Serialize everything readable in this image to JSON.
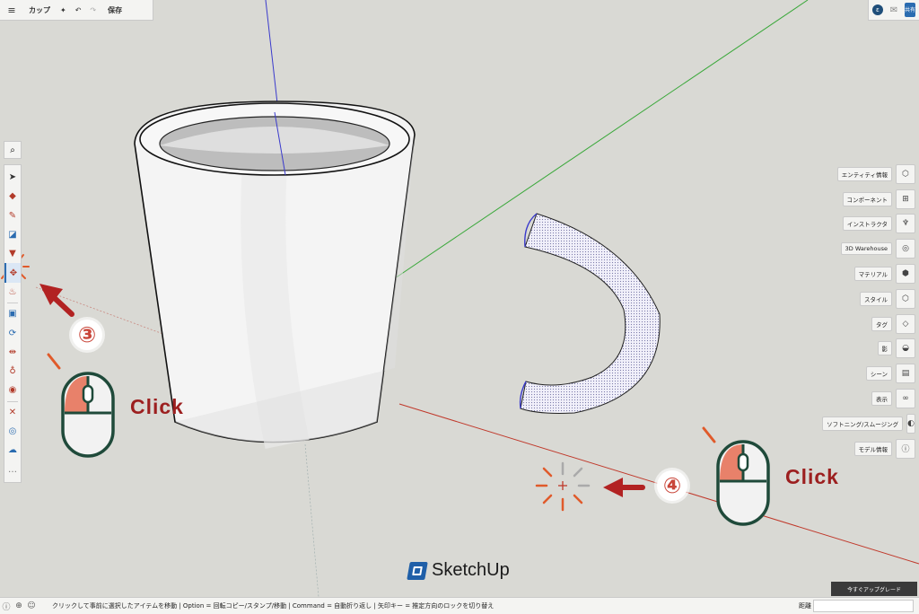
{
  "topbar": {
    "menu_icon": "hamburger-menu-icon",
    "title": "カップ",
    "save_label": "保存"
  },
  "topright": {
    "avatar_text": "ε",
    "share_label": "共有"
  },
  "left_toolbar": {
    "tools": [
      "select-icon",
      "eraser-icon",
      "pencil-icon",
      "rectangle-icon",
      "paint-icon",
      "move-icon",
      "push-pull-icon",
      "offset-icon",
      "rotate-icon",
      "scale-icon",
      "tape-measure-icon",
      "orbit-icon",
      "pan-icon",
      "zoom-icon",
      "section-icon",
      "more-icon"
    ]
  },
  "right_panel": {
    "items": [
      "エンティティ情報",
      "コンポーネント",
      "インストラクタ",
      "3D Warehouse",
      "マテリアル",
      "スタイル",
      "タグ",
      "影",
      "シーン",
      "表示",
      "ソフトニング/スムージング",
      "モデル情報"
    ]
  },
  "upgrade_label": "今すぐアップグレード",
  "brand": "SketchUp",
  "status": {
    "message": "クリックして事前に選択したアイテムを移動 | Option = 回転コピー/スタンプ/移動 | Command = 自動折り返し | 矢印キー = 推定方向のロックを切り替え",
    "distance_label": "距離"
  },
  "annotations": {
    "step3": "③",
    "step4": "④",
    "click_label_1": "Click",
    "click_label_2": "Click"
  },
  "colors": {
    "accent": "#c9463a",
    "mouse_body": "#1f4a3a",
    "axis_red": "#c0392b",
    "axis_green": "#3aa83a",
    "axis_blue": "#3a3acc"
  }
}
